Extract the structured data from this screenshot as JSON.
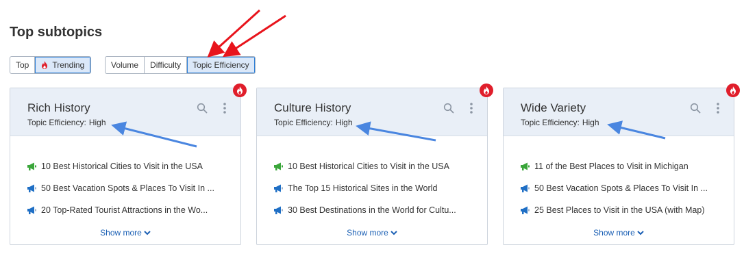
{
  "title": "Top subtopics",
  "sort_tabs": [
    {
      "label": "Top",
      "active": false
    },
    {
      "label": "Trending",
      "active": true,
      "icon": "flame-icon"
    }
  ],
  "metric_tabs": [
    {
      "label": "Volume",
      "active": false
    },
    {
      "label": "Difficulty",
      "active": false
    },
    {
      "label": "Topic Efficiency",
      "active": true
    }
  ],
  "colors": {
    "accent": "#2e7fd6",
    "link": "#1a5fb4",
    "trending_badge": "#e01e2b",
    "annotation_red": "#e8141c",
    "annotation_blue": "#4a86e0",
    "icon_green": "#3aa63a",
    "icon_blue": "#1f6fc5"
  },
  "cards": [
    {
      "name": "Rich History",
      "efficiency_label": "Topic Efficiency:",
      "efficiency_value": "High",
      "trending": true,
      "items": [
        {
          "icon": "megaphone-green-icon",
          "text": "10 Best Historical Cities to Visit in the USA"
        },
        {
          "icon": "megaphone-blue-icon",
          "text": "50 Best Vacation Spots & Places To Visit In ..."
        },
        {
          "icon": "megaphone-blue-icon",
          "text": "20 Top-Rated Tourist Attractions in the Wo..."
        }
      ],
      "show_more": "Show more"
    },
    {
      "name": "Culture History",
      "efficiency_label": "Topic Efficiency:",
      "efficiency_value": "High",
      "trending": true,
      "items": [
        {
          "icon": "megaphone-green-icon",
          "text": "10 Best Historical Cities to Visit in the USA"
        },
        {
          "icon": "megaphone-blue-icon",
          "text": "The Top 15 Historical Sites in the World"
        },
        {
          "icon": "megaphone-blue-icon",
          "text": "30 Best Destinations in the World for Cultu..."
        }
      ],
      "show_more": "Show more"
    },
    {
      "name": "Wide Variety",
      "efficiency_label": "Topic Efficiency:",
      "efficiency_value": "High",
      "trending": true,
      "items": [
        {
          "icon": "megaphone-green-icon",
          "text": "11 of the Best Places to Visit in Michigan"
        },
        {
          "icon": "megaphone-blue-icon",
          "text": "50 Best Vacation Spots & Places To Visit In ..."
        },
        {
          "icon": "megaphone-blue-icon",
          "text": "25 Best Places to Visit in the USA (with Map)"
        }
      ],
      "show_more": "Show more"
    }
  ]
}
